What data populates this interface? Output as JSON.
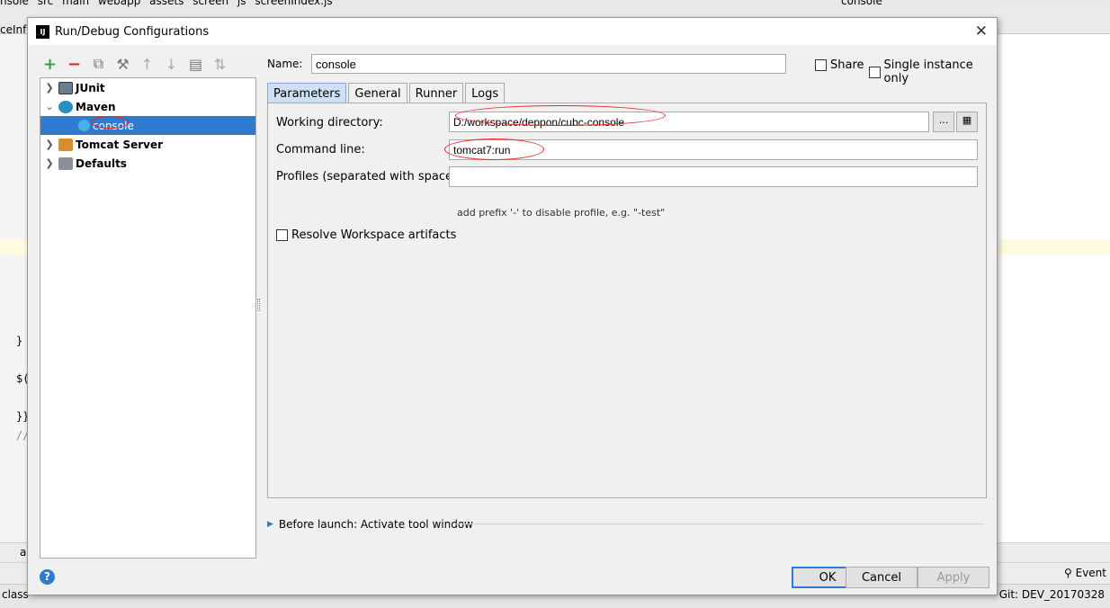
{
  "ide": {
    "breadcrumb": [
      "nsole",
      "src",
      "main",
      "webapp",
      "assets",
      "screen",
      "js",
      "screenIndex.js"
    ],
    "run_config": "console",
    "tab_left": "ceInfo",
    "code_lines": [
      "}",
      "$(",
      "}}",
      "//"
    ],
    "bottom_tab": "a",
    "status_left": "class",
    "status_git": "Git: DEV_20170328",
    "event_label": "Event"
  },
  "dialog": {
    "title": "Run/Debug Configurations",
    "logo_text": "IJ",
    "close_symbol": "✕",
    "name_label": "Name:",
    "name_value": "console",
    "share_label": "Share",
    "single_instance_label": "Single instance only",
    "tree": [
      {
        "label": "JUnit",
        "expanded": false
      },
      {
        "label": "Maven",
        "expanded": true
      },
      {
        "label": "console",
        "selected": true
      },
      {
        "label": "Tomcat Server",
        "expanded": false
      },
      {
        "label": "Defaults",
        "expanded": false
      }
    ],
    "tabs": [
      "Parameters",
      "General",
      "Runner",
      "Logs"
    ],
    "active_tab": "Parameters",
    "working_directory_label": "Working directory:",
    "working_directory_value": "D:/workspace/deppon/cubc-console",
    "command_line_label": "Command line:",
    "command_line_value": "tomcat7:run",
    "profiles_label": "Profiles (separated with space):",
    "profiles_value": "",
    "profiles_hint": "add prefix '-' to disable profile, e.g. \"-test\"",
    "resolve_workspace_label": "Resolve Workspace artifacts",
    "browse_label": "...",
    "before_launch_label": "Before launch: Activate tool window",
    "help_symbol": "?",
    "ok_label": "OK",
    "cancel_label": "Cancel",
    "apply_label": "Apply"
  },
  "colors": {
    "selection": "#2e7bcf",
    "annotation_oval": "#e22222",
    "active_tab": "#cfe0f5"
  },
  "icons": {
    "toolbar": [
      "add-icon",
      "remove-icon",
      "copy-icon",
      "edit-defaults-icon",
      "move-up-icon",
      "move-down-icon",
      "folder-icon",
      "sort-icon"
    ]
  }
}
